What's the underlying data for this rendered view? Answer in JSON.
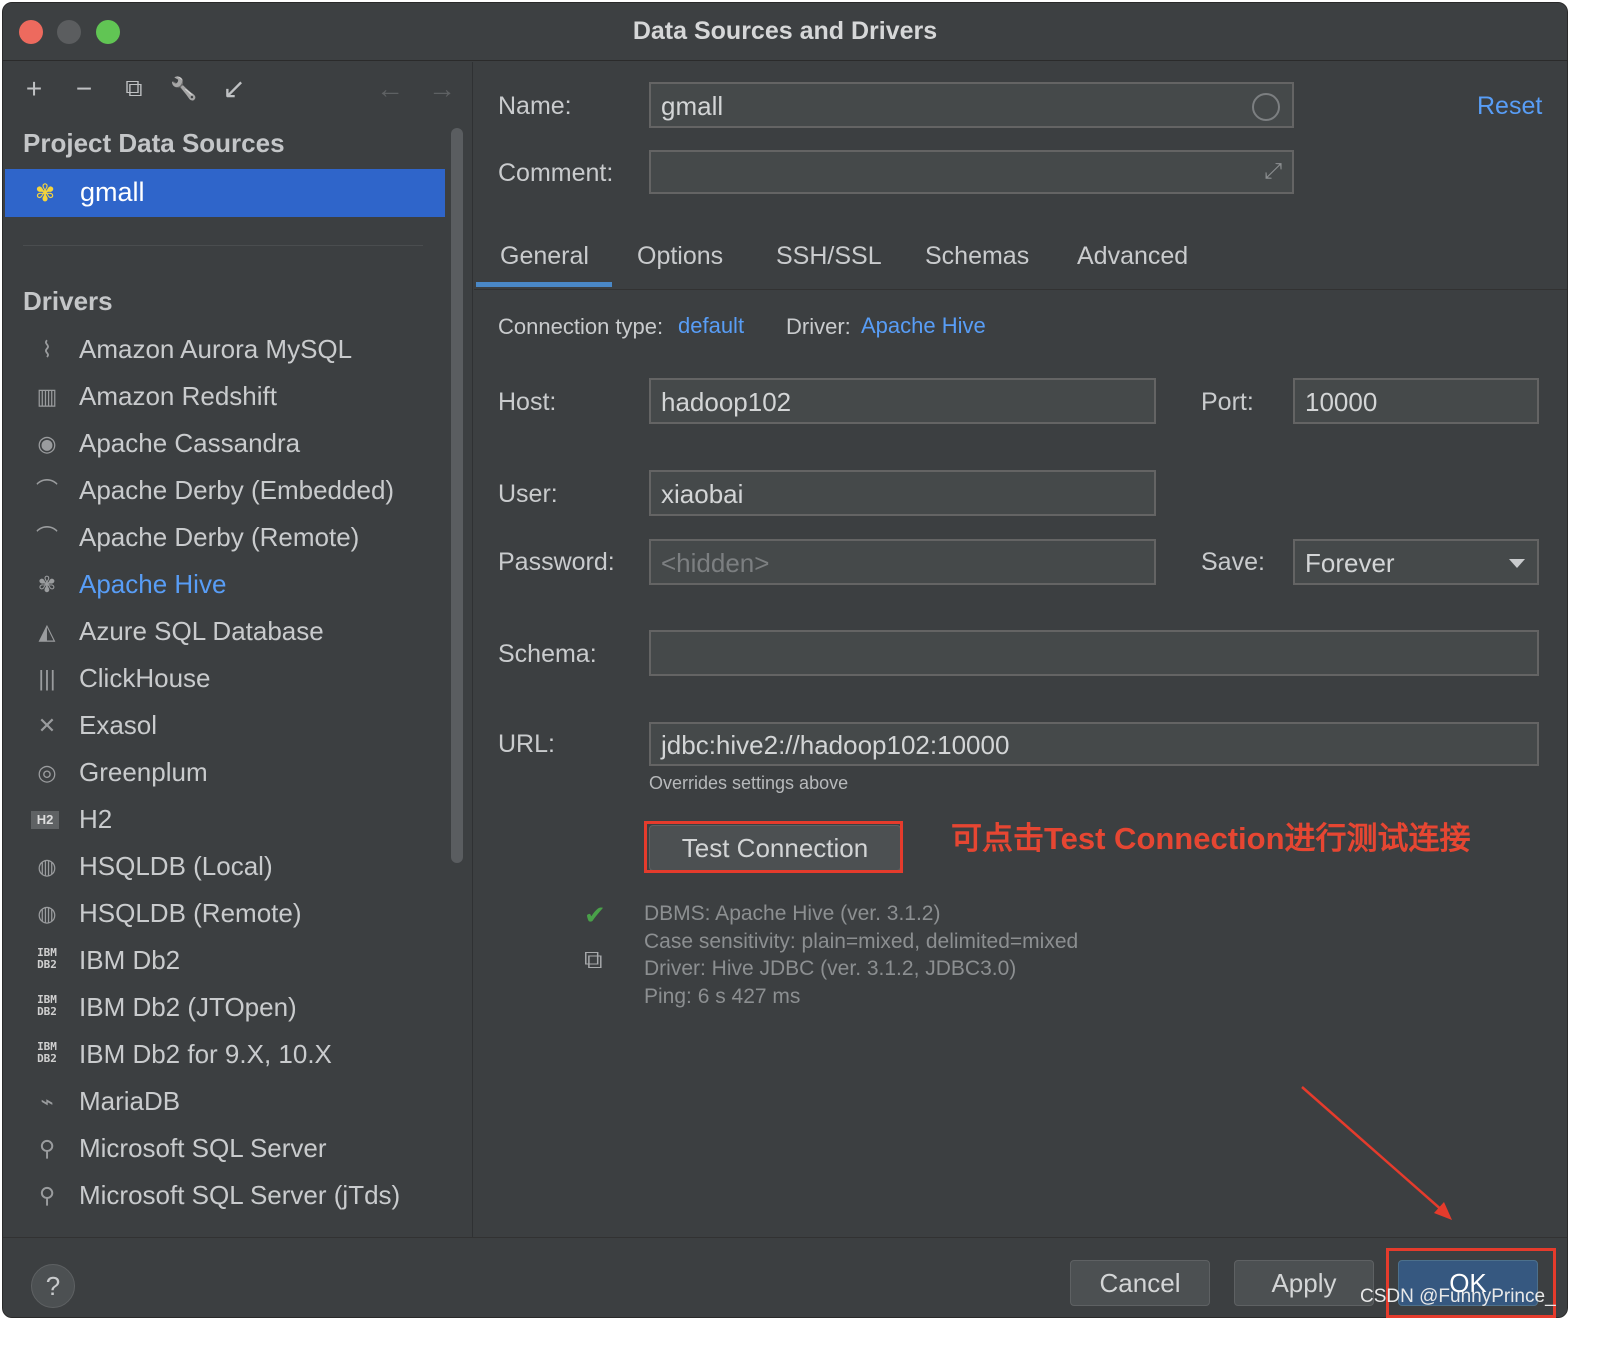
{
  "window": {
    "title": "Data Sources and Drivers"
  },
  "toolbar": {
    "add": "+",
    "remove": "−",
    "copy": "⧉",
    "settings": "🔧",
    "import": "↙",
    "back": "←",
    "forward": "→"
  },
  "left": {
    "project_title": "Project Data Sources",
    "selected_source": "gmall",
    "drivers_title": "Drivers",
    "drivers": [
      {
        "label": "Amazon Aurora MySQL",
        "icon": "dolphin-icon"
      },
      {
        "label": "Amazon Redshift",
        "icon": "redshift-icon"
      },
      {
        "label": "Apache Cassandra",
        "icon": "eye-icon"
      },
      {
        "label": "Apache Derby (Embedded)",
        "icon": "derby-hat-icon"
      },
      {
        "label": "Apache Derby (Remote)",
        "icon": "derby-hat-icon"
      },
      {
        "label": "Apache Hive",
        "icon": "hive-icon",
        "active": true
      },
      {
        "label": "Azure SQL Database",
        "icon": "azure-icon"
      },
      {
        "label": "ClickHouse",
        "icon": "clickhouse-icon"
      },
      {
        "label": "Exasol",
        "icon": "exasol-icon"
      },
      {
        "label": "Greenplum",
        "icon": "greenplum-icon"
      },
      {
        "label": "H2",
        "icon": "h2-icon"
      },
      {
        "label": "HSQLDB (Local)",
        "icon": "hsqldb-icon"
      },
      {
        "label": "HSQLDB (Remote)",
        "icon": "hsqldb-icon"
      },
      {
        "label": "IBM Db2",
        "icon": "ibm-db2-icon"
      },
      {
        "label": "IBM Db2 (JTOpen)",
        "icon": "ibm-db2-icon"
      },
      {
        "label": "IBM Db2 for 9.X, 10.X",
        "icon": "ibm-db2-icon"
      },
      {
        "label": "MariaDB",
        "icon": "mariadb-seal-icon"
      },
      {
        "label": "Microsoft SQL Server",
        "icon": "mssql-icon"
      },
      {
        "label": "Microsoft SQL Server (jTds)",
        "icon": "mssql-icon"
      }
    ]
  },
  "form": {
    "name_label": "Name:",
    "name_value": "gmall",
    "reset": "Reset",
    "comment_label": "Comment:",
    "comment_value": "",
    "tabs": [
      "General",
      "Options",
      "SSH/SSL",
      "Schemas",
      "Advanced"
    ],
    "connection_type_label": "Connection type:",
    "connection_type_value": "default",
    "driver_label": "Driver:",
    "driver_value": "Apache Hive",
    "host_label": "Host:",
    "host_value": "hadoop102",
    "port_label": "Port:",
    "port_value": "10000",
    "user_label": "User:",
    "user_value": "xiaobai",
    "password_label": "Password:",
    "password_placeholder": "<hidden>",
    "save_label": "Save:",
    "save_value": "Forever",
    "schema_label": "Schema:",
    "schema_value": "",
    "url_label": "URL:",
    "url_value": "jdbc:hive2://hadoop102:10000",
    "url_hint": "Overrides settings above",
    "test_connection": "Test Connection",
    "annotation": "可点击Test Connection进行测试连接",
    "status": {
      "dbms": "DBMS: Apache Hive (ver. 3.1.2)",
      "case": "Case sensitivity: plain=mixed, delimited=mixed",
      "driver": "Driver: Hive JDBC (ver. 3.1.2, JDBC3.0)",
      "ping": "Ping: 6 s 427 ms"
    }
  },
  "buttons": {
    "help": "?",
    "cancel": "Cancel",
    "apply": "Apply",
    "ok": "OK"
  },
  "watermark": "CSDN @FunnyPrince_",
  "colors": {
    "accent": "#589df6",
    "selection": "#2f65ca",
    "annotation": "#e53b2c",
    "success": "#49a049"
  }
}
